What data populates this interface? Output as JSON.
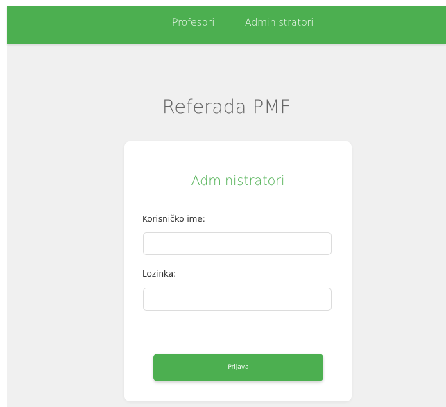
{
  "nav": {
    "items": [
      {
        "label": "Profesori"
      },
      {
        "label": "Administratori"
      }
    ]
  },
  "page": {
    "title": "Referada PMF"
  },
  "login_form": {
    "title": "Administratori",
    "username_label": "Korisničko ime:",
    "username_value": "",
    "password_label": "Lozinka:",
    "password_value": "",
    "submit_label": "Prijava"
  },
  "colors": {
    "accent": "#4caf50",
    "background": "#f0f0f0",
    "card": "#ffffff",
    "title_text": "#666666"
  }
}
